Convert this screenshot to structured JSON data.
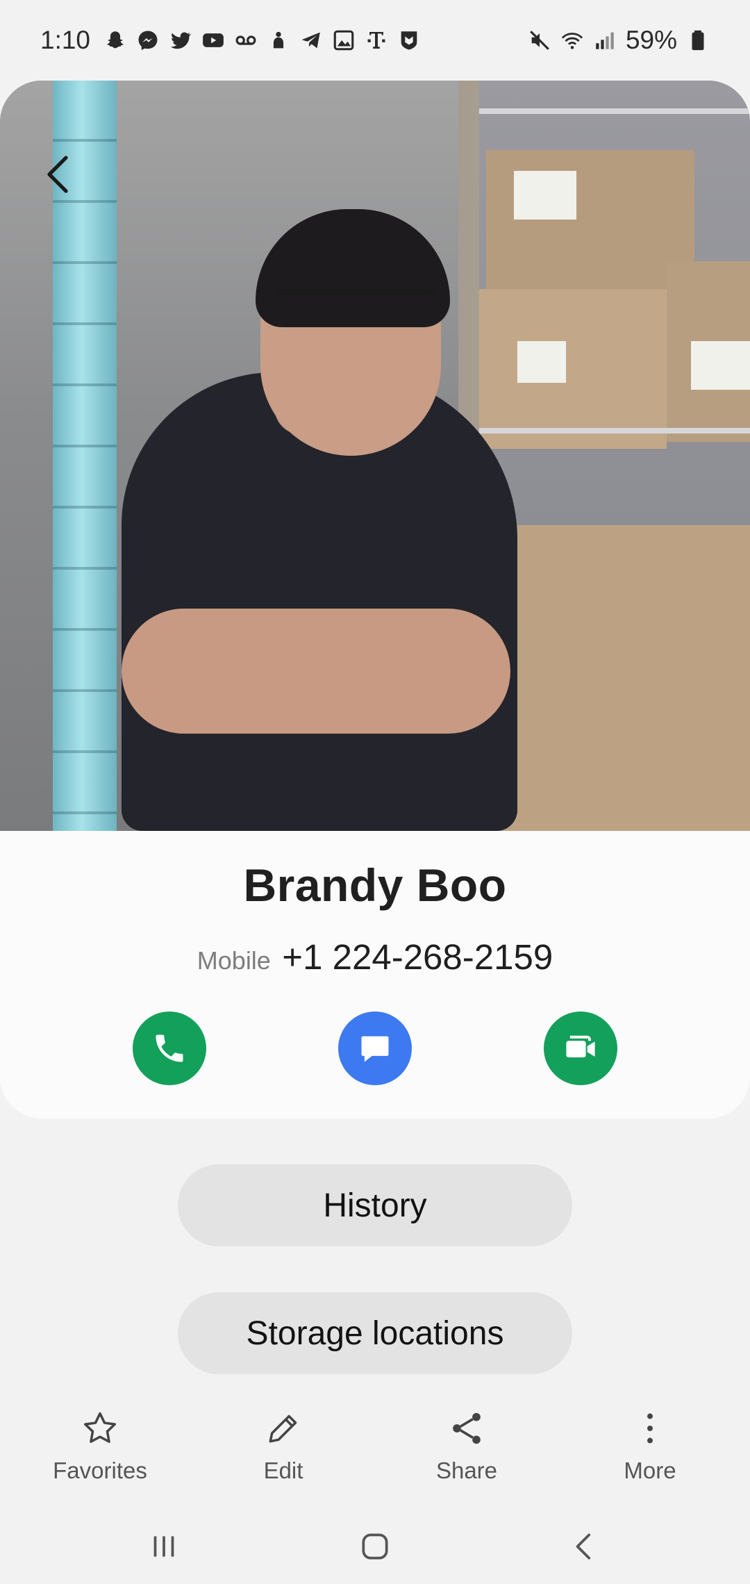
{
  "status_bar": {
    "time": "1:10",
    "battery": "59%",
    "icons_left": [
      "snapchat-icon",
      "messenger-icon",
      "twitter-icon",
      "youtube-icon",
      "voicemail-icon",
      "app-icon",
      "telegram-icon",
      "gallery-icon",
      "tmobile-icon",
      "shield-app-icon"
    ],
    "icons_right": [
      "mute-icon",
      "wifi-icon",
      "signal-icon",
      "battery-icon"
    ]
  },
  "contact": {
    "name": "Brandy Boo",
    "phone_label": "Mobile",
    "phone_number": "+1 224-268-2159"
  },
  "actions": {
    "call_icon": "phone-icon",
    "message_icon": "message-icon",
    "video_icon": "video-call-icon",
    "call_color": "#13a05a",
    "message_color": "#3d79f0",
    "video_color": "#13a05a"
  },
  "buttons": {
    "history": "History",
    "storage": "Storage locations"
  },
  "toolbar": {
    "favorites": "Favorites",
    "edit": "Edit",
    "share": "Share",
    "more": "More"
  }
}
